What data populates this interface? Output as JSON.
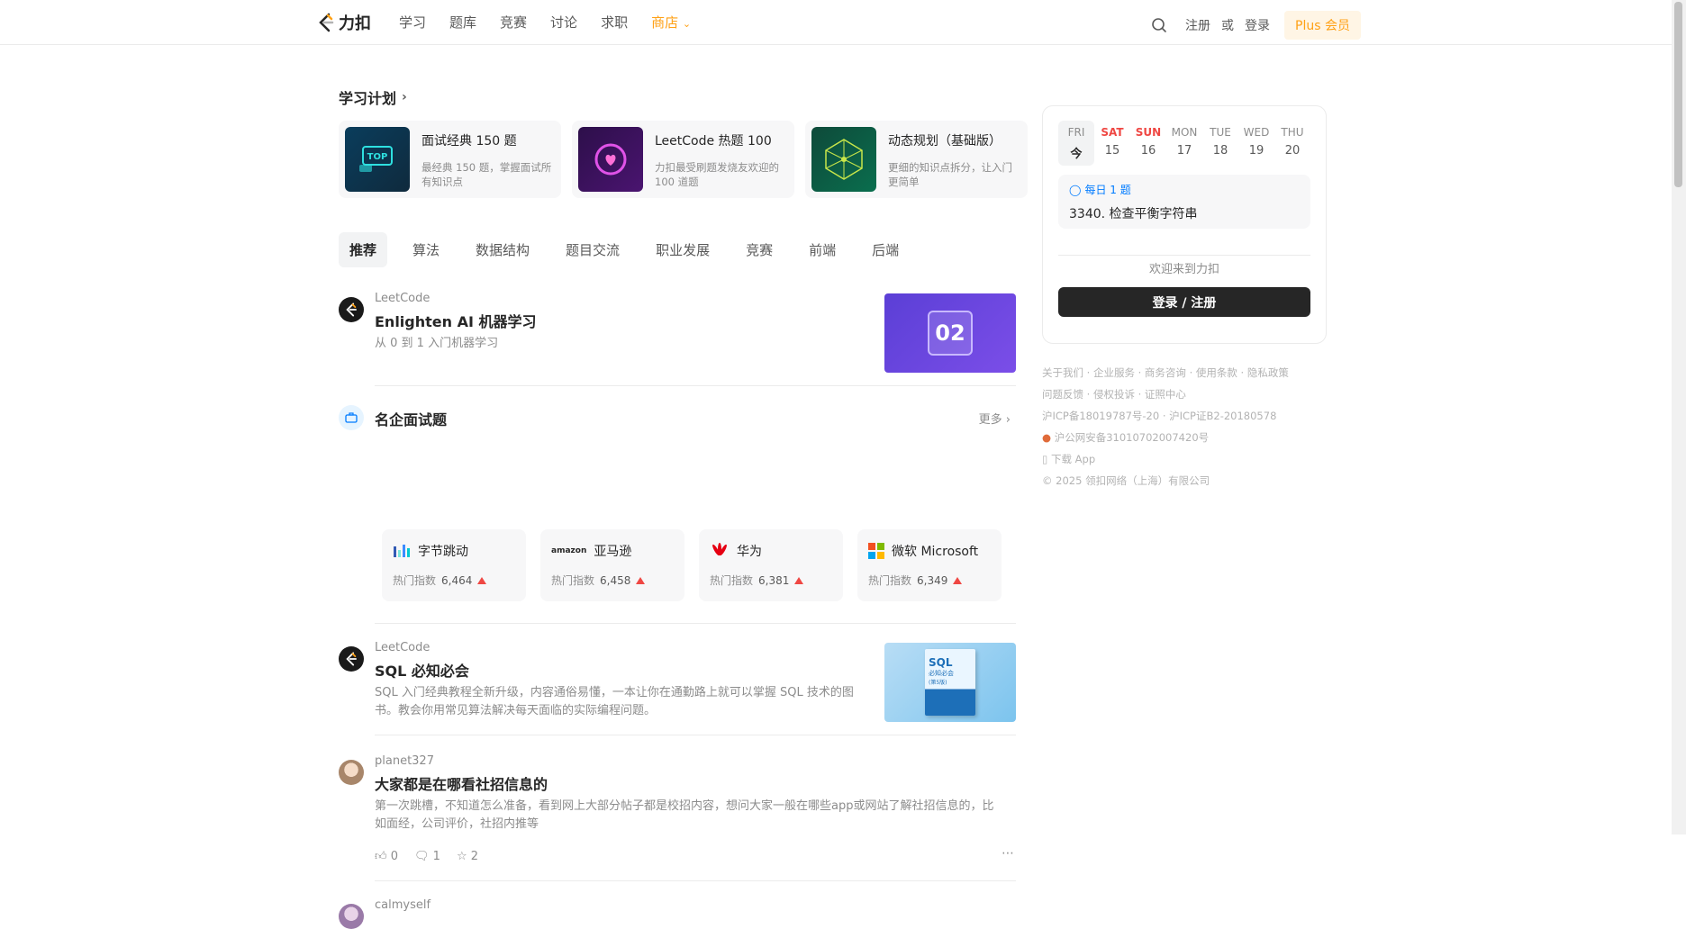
{
  "header": {
    "logo_text": "力扣",
    "nav": [
      "学习",
      "题库",
      "竞赛",
      "讨论",
      "求职",
      "商店"
    ],
    "register": "注册",
    "or": "或",
    "login": "登录",
    "plus": "Plus 会员"
  },
  "study_plan": {
    "title": "学习计划",
    "plans": [
      {
        "title": "面试经典 150 题",
        "desc": "最经典 150 题，掌握面试所有知识点"
      },
      {
        "title": "LeetCode 热题 100",
        "desc": "力扣最受刷题发烧友欢迎的 100 道题"
      },
      {
        "title": "动态规划（基础版）",
        "desc": "更细的知识点拆分，让入门更简单"
      }
    ]
  },
  "tabs": [
    "推荐",
    "算法",
    "数据结构",
    "题目交流",
    "职业发展",
    "竞赛",
    "前端",
    "后端"
  ],
  "feed": {
    "post1": {
      "author": "LeetCode",
      "title": "Enlighten AI 机器学习",
      "desc": "从 0 到 1 入门机器学习",
      "thumb_text": "02"
    },
    "companies_section": {
      "title": "名企面试题",
      "more": "更多",
      "items": [
        {
          "name": "字节跳动",
          "heat_label": "热门指数",
          "heat": "6,464"
        },
        {
          "name": "亚马逊",
          "heat_label": "热门指数",
          "heat": "6,458"
        },
        {
          "name": "华为",
          "heat_label": "热门指数",
          "heat": "6,381"
        },
        {
          "name": "微软 Microsoft",
          "heat_label": "热门指数",
          "heat": "6,349"
        }
      ],
      "amazon_logo": "amazon"
    },
    "post2": {
      "author": "LeetCode",
      "title": "SQL 必知必会",
      "desc": "SQL 入门经典教程全新升级，内容通俗易懂，一本让你在通勤路上就可以掌握 SQL 技术的图书。教会你用常见算法解决每天面临的实际编程问题。",
      "book_title": "SQL",
      "book_sub": "必知必会",
      "book_ed": "(第5版)"
    },
    "post3": {
      "author": "planet327",
      "title": "大家都是在哪看社招信息的",
      "desc": "第一次跳槽，不知道怎么准备，看到网上大部分帖子都是校招内容，想问大家一般在哪些app或网站了解社招信息的，比如面经，公司评价，社招内推等",
      "likes": "0",
      "comments": "1",
      "stars": "2"
    },
    "post4": {
      "author": "calmyself"
    }
  },
  "sidebar": {
    "calendar": [
      {
        "dw": "FRI",
        "dn": "今"
      },
      {
        "dw": "SAT",
        "dn": "15"
      },
      {
        "dw": "SUN",
        "dn": "16"
      },
      {
        "dw": "MON",
        "dn": "17"
      },
      {
        "dw": "TUE",
        "dn": "18"
      },
      {
        "dw": "WED",
        "dn": "19"
      },
      {
        "dw": "THU",
        "dn": "20"
      }
    ],
    "daily_tag": "每日 1 题",
    "daily_question": "3340. 检查平衡字符串",
    "welcome": "欢迎来到力扣",
    "login_button": "登录 / 注册",
    "footer": {
      "line1": "关于我们 · 企业服务 · 商务咨询 · 使用条款 · 隐私政策",
      "line2": "问题反馈 · 侵权投诉 · 证照中心",
      "line3": "沪ICP备18019787号-20 · 沪ICP证B2-20180578",
      "line4": "沪公网安备31010702007420号",
      "line5": "下载 App",
      "line6": "© 2025 领扣网络（上海）有限公司"
    }
  }
}
